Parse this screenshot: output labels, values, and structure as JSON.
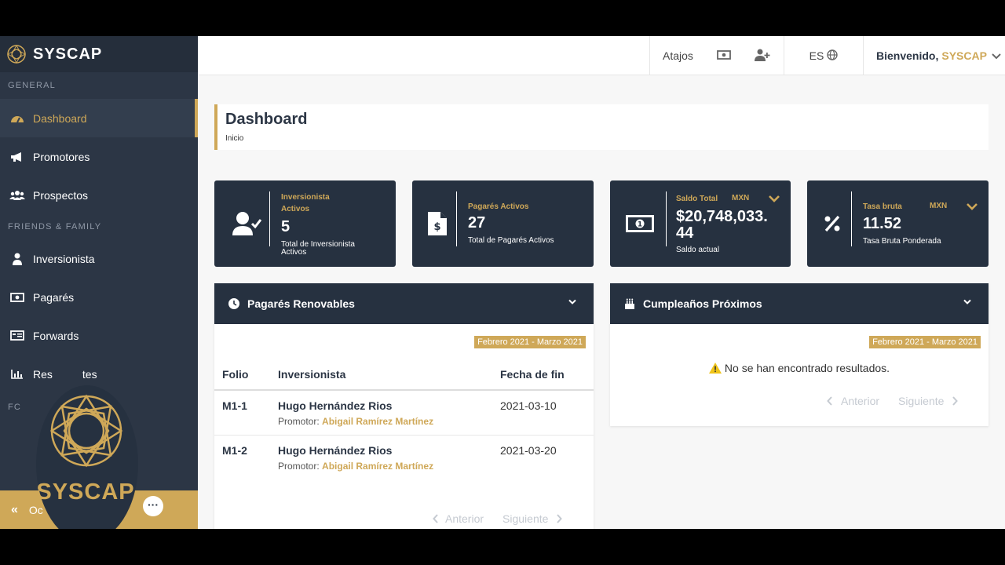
{
  "brand": {
    "name": "SYSCAP"
  },
  "sidebar": {
    "section_general": "GENERAL",
    "section_ff": "FRIENDS & FAMILY",
    "section_partial": "FC",
    "items": [
      {
        "label": "Dashboard",
        "icon": "gauge-icon"
      },
      {
        "label": "Promotores",
        "icon": "megaphone-icon"
      },
      {
        "label": "Prospectos",
        "icon": "users-icon"
      },
      {
        "label": "Inversionista",
        "icon": "user-tie-icon"
      },
      {
        "label": "Pagarés",
        "icon": "money-icon"
      },
      {
        "label": "Forwards",
        "icon": "card-icon"
      },
      {
        "label": "Res",
        "label_tail": "tes",
        "icon": "bar-chart-icon"
      }
    ],
    "collapse_label": "Ocultar",
    "collapse_visible": "Oc"
  },
  "overlay": {
    "logo_text": "SYSCAP"
  },
  "topbar": {
    "shortcuts": "Atajos",
    "lang": "ES",
    "welcome": "Bienvenido,",
    "user": "SYSCAP"
  },
  "page": {
    "title": "Dashboard",
    "breadcrumb": "Inicio"
  },
  "stats": [
    {
      "label_1": "Inversionista",
      "label_2": "Activos",
      "value": "5",
      "desc_1": "Total de Inversionista",
      "desc_2": "Activos",
      "icon": "user-check-icon"
    },
    {
      "label_1": "Pagarés Activos",
      "value": "27",
      "desc_1": "Total de Pagarés Activos",
      "icon": "file-invoice-dollar-icon"
    },
    {
      "label_1": "Saldo Total",
      "currency": "MXN",
      "value_1": "$20,748,033.",
      "value_2": "44",
      "desc_1": "Saldo actual",
      "icon": "money-bill-icon"
    },
    {
      "label_1": "Tasa bruta",
      "currency": "MXN",
      "value": "11.52",
      "desc_1": "Tasa Bruta Ponderada",
      "icon": "percent-icon"
    }
  ],
  "renewables": {
    "title": "Pagarés Renovables",
    "range": "Febrero 2021 - Marzo 2021",
    "columns": [
      "Folio",
      "Inversionista",
      "Fecha de fin"
    ],
    "promoter_label": "Promotor:",
    "rows": [
      {
        "folio": "M1-1",
        "investor": "Hugo Hernández Rios",
        "promoter": "Abigail Ramírez Martínez",
        "end": "2021-03-10"
      },
      {
        "folio": "M1-2",
        "investor": "Hugo Hernández Rios",
        "promoter": "Abigail Ramírez Martínez",
        "end": "2021-03-20"
      }
    ],
    "prev": "Anterior",
    "next": "Siguiente"
  },
  "birthdays": {
    "title": "Cumpleaños Próximos",
    "range": "Febrero 2021 - Marzo 2021",
    "empty": "No se han encontrado resultados.",
    "prev": "Anterior",
    "next": "Siguiente"
  },
  "colors": {
    "accent": "#cfa858",
    "dark": "#263140",
    "sidebar": "#2c3645"
  }
}
